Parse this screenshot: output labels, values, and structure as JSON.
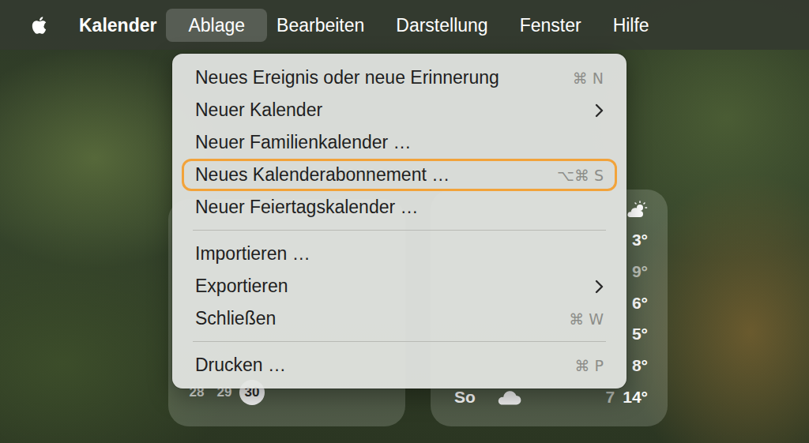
{
  "menubar": {
    "items": [
      {
        "label": "Kalender",
        "kind": "app",
        "selected": false
      },
      {
        "label": "Ablage",
        "kind": "menu",
        "selected": true
      },
      {
        "label": "Bearbeiten",
        "kind": "menu",
        "selected": false
      },
      {
        "label": "Darstellung",
        "kind": "menu",
        "selected": false
      },
      {
        "label": "Fenster",
        "kind": "menu",
        "selected": false
      },
      {
        "label": "Hilfe",
        "kind": "menu",
        "selected": false
      }
    ]
  },
  "menu": {
    "items": [
      {
        "kind": "item",
        "label": "Neues Ereignis oder neue Erinnerung",
        "shortcut": "⌘ N",
        "submenu": false,
        "outlined": false
      },
      {
        "kind": "item",
        "label": "Neuer Kalender",
        "submenu": true,
        "outlined": false
      },
      {
        "kind": "item",
        "label": "Neuer Familienkalender …",
        "submenu": false,
        "outlined": false
      },
      {
        "kind": "item",
        "label": "Neues Kalenderabonnement …",
        "shortcut": "⌥⌘ S",
        "submenu": false,
        "outlined": true
      },
      {
        "kind": "item",
        "label": "Neuer Feiertagskalender …",
        "submenu": false,
        "outlined": false
      },
      {
        "kind": "separator"
      },
      {
        "kind": "item",
        "label": "Importieren …",
        "submenu": false,
        "outlined": false
      },
      {
        "kind": "item",
        "label": "Exportieren",
        "submenu": true,
        "outlined": false
      },
      {
        "kind": "item",
        "label": "Schließen",
        "shortcut": "⌘ W",
        "submenu": false,
        "outlined": false
      },
      {
        "kind": "separator"
      },
      {
        "kind": "item",
        "label": "Drucken …",
        "shortcut": "⌘ P",
        "submenu": false,
        "outlined": false
      }
    ]
  },
  "calendar_widget": {
    "days": [
      {
        "label": "28",
        "today": false
      },
      {
        "label": "29",
        "today": false
      },
      {
        "label": "30",
        "today": true
      }
    ]
  },
  "weather_widget": {
    "temps": [
      {
        "label": "3°",
        "dim": false
      },
      {
        "label": "9°",
        "dim": true
      },
      {
        "label": "6°",
        "dim": false
      },
      {
        "label": "5°",
        "dim": false
      },
      {
        "label": "8°",
        "dim": false
      }
    ],
    "forecast": {
      "day": "So",
      "low": "7",
      "high": "14°"
    }
  }
}
